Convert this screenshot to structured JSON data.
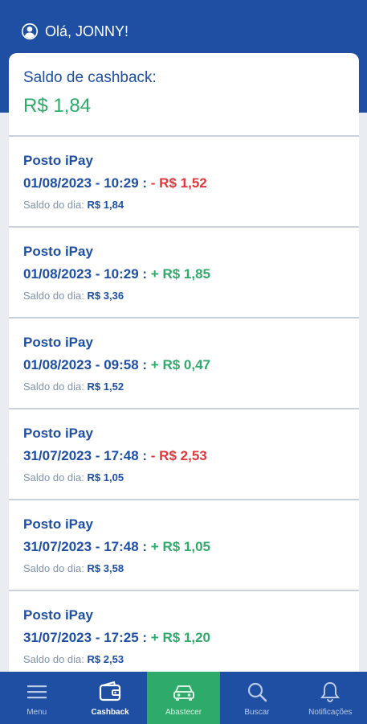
{
  "header": {
    "greeting": "Olá, JONNY!"
  },
  "balance": {
    "label": "Saldo de cashback:",
    "value": "R$ 1,84"
  },
  "transactions": [
    {
      "name": "Posto iPay",
      "datetime": "01/08/2023 - 10:29 :",
      "amount": "- R$ 1,52",
      "type": "debit",
      "day_balance_label": "Saldo do dia:",
      "day_balance_value": "R$ 1,84"
    },
    {
      "name": "Posto iPay",
      "datetime": "01/08/2023 - 10:29 :",
      "amount": "+ R$ 1,85",
      "type": "credit",
      "day_balance_label": "Saldo do dia:",
      "day_balance_value": "R$ 3,36"
    },
    {
      "name": "Posto iPay",
      "datetime": "01/08/2023 - 09:58 :",
      "amount": "+ R$ 0,47",
      "type": "credit",
      "day_balance_label": "Saldo do dia:",
      "day_balance_value": "R$ 1,52"
    },
    {
      "name": "Posto iPay",
      "datetime": "31/07/2023 - 17:48 :",
      "amount": "- R$ 2,53",
      "type": "debit",
      "day_balance_label": "Saldo do dia:",
      "day_balance_value": "R$ 1,05"
    },
    {
      "name": "Posto iPay",
      "datetime": "31/07/2023 - 17:48 :",
      "amount": "+ R$ 1,05",
      "type": "credit",
      "day_balance_label": "Saldo do dia:",
      "day_balance_value": "R$ 3,58"
    },
    {
      "name": "Posto iPay",
      "datetime": "31/07/2023 - 17:25 :",
      "amount": "+ R$ 1,20",
      "type": "credit",
      "day_balance_label": "Saldo do dia:",
      "day_balance_value": "R$ 2,53"
    }
  ],
  "nav": {
    "menu": "Menu",
    "cashback": "Cashback",
    "fuel": "Abastecer",
    "search": "Buscar",
    "notifications": "Notificações",
    "active_tab": "Cashback"
  },
  "colors": {
    "brand_blue": "#1e4fa3",
    "credit_green": "#2eaa6a",
    "debit_red": "#e0373a"
  },
  "icons": [
    "user-icon",
    "menu-icon",
    "wallet-icon",
    "car-icon",
    "search-icon",
    "bell-icon"
  ]
}
